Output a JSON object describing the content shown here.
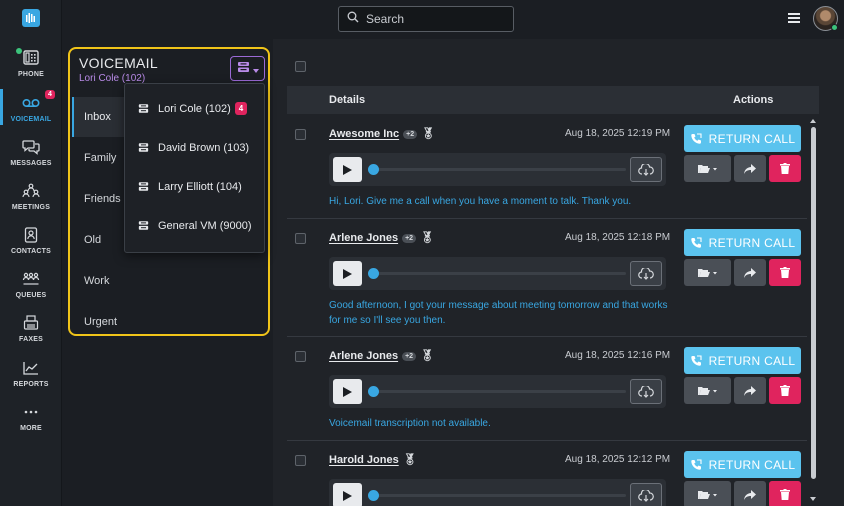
{
  "nav": {
    "items": [
      {
        "label": "PHONE",
        "icon": "phone-icon"
      },
      {
        "label": "VOICEMAIL",
        "icon": "voicemail-icon",
        "badge": "4"
      },
      {
        "label": "MESSAGES",
        "icon": "messages-icon"
      },
      {
        "label": "MEETINGS",
        "icon": "meetings-icon"
      },
      {
        "label": "CONTACTS",
        "icon": "contacts-icon"
      },
      {
        "label": "QUEUES",
        "icon": "queues-icon"
      },
      {
        "label": "FAXES",
        "icon": "faxes-icon"
      },
      {
        "label": "REPORTS",
        "icon": "reports-icon"
      },
      {
        "label": "MORE",
        "icon": "more-icon"
      }
    ]
  },
  "search": {
    "placeholder": "Search"
  },
  "panel": {
    "title": "VOICEMAIL",
    "subtitle": "Lori Cole (102)",
    "folders": [
      "Inbox",
      "Family",
      "Friends",
      "Old",
      "Work",
      "Urgent"
    ]
  },
  "dropdown": {
    "items": [
      {
        "label": "Lori Cole (102)",
        "badge": "4"
      },
      {
        "label": "David Brown (103)"
      },
      {
        "label": "Larry Elliott (104)"
      },
      {
        "label": "General VM (9000)"
      }
    ]
  },
  "table": {
    "col_details": "Details",
    "col_actions": "Actions",
    "return_call_label": "RETURN CALL",
    "rows": [
      {
        "caller": "Awesome Inc",
        "extra": "+2",
        "date": "Aug 18, 2025 12:19 PM",
        "transcription": "Hi, Lori. Give me a call when you have a moment to talk. Thank you."
      },
      {
        "caller": "Arlene Jones",
        "extra": "+2",
        "date": "Aug 18, 2025 12:18 PM",
        "transcription": "Good afternoon, I got your message about meeting tomorrow and that works for me so I'll see you then."
      },
      {
        "caller": "Arlene Jones",
        "extra": "+2",
        "date": "Aug 18, 2025 12:16 PM",
        "transcription": "Voicemail transcription not available."
      },
      {
        "caller": "Harold Jones",
        "extra": "",
        "date": "Aug 18, 2025 12:12 PM",
        "transcription": ""
      }
    ]
  },
  "colors": {
    "accent": "#39a7e2",
    "highlight": "#f0c419",
    "danger": "#e0245e",
    "return_call": "#5bc3ee",
    "subtitle": "#b98be8"
  }
}
